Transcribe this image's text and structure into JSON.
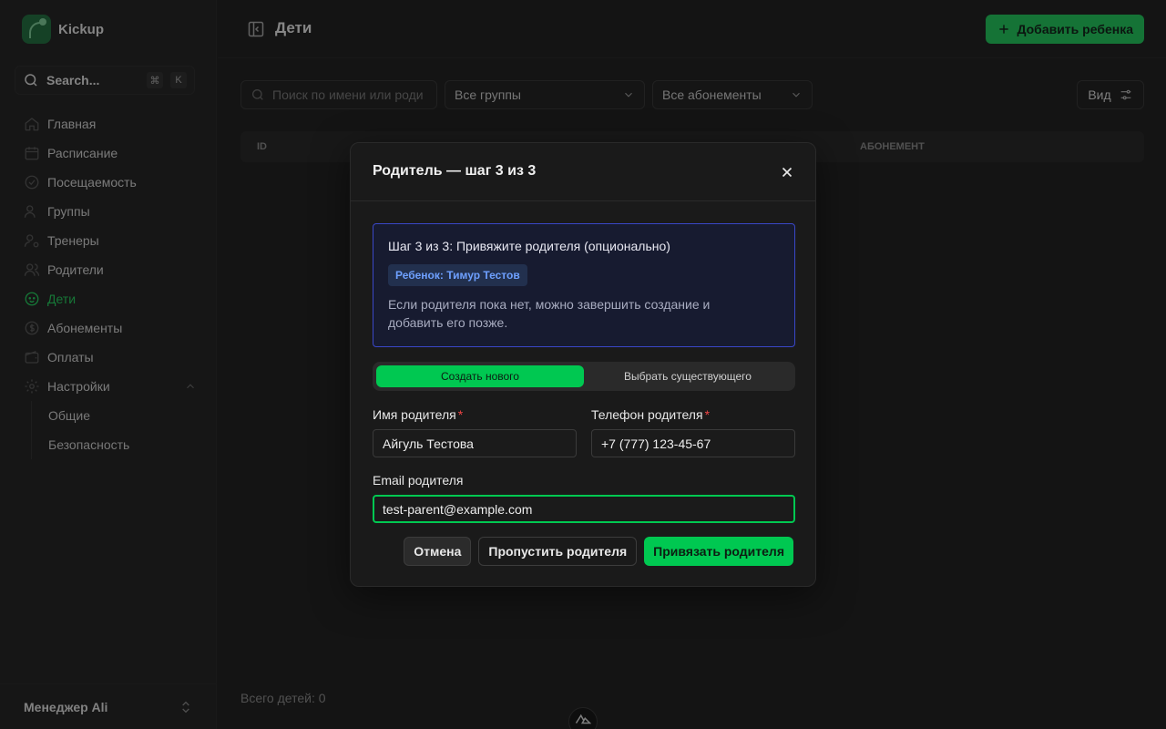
{
  "brand": {
    "name": "Kickup"
  },
  "search": {
    "label": "Search...",
    "kbd1": "⌘",
    "kbd2": "K"
  },
  "nav": {
    "items": [
      {
        "label": "Главная",
        "icon": "home-icon"
      },
      {
        "label": "Расписание",
        "icon": "calendar-icon"
      },
      {
        "label": "Посещаемость",
        "icon": "check-circle-icon"
      },
      {
        "label": "Группы",
        "icon": "users-icon"
      },
      {
        "label": "Тренеры",
        "icon": "user-cog-icon"
      },
      {
        "label": "Родители",
        "icon": "users-icon"
      },
      {
        "label": "Дети",
        "icon": "baby-icon",
        "active": true
      },
      {
        "label": "Абонементы",
        "icon": "dollar-circle-icon"
      },
      {
        "label": "Оплаты",
        "icon": "wallet-icon"
      },
      {
        "label": "Настройки",
        "icon": "gear-icon"
      }
    ],
    "settings_sub": [
      "Общие",
      "Безопасность"
    ]
  },
  "user": {
    "name": "Менеджер Ali"
  },
  "header": {
    "title": "Дети",
    "add_label": "Добавить ребенка"
  },
  "filters": {
    "search_placeholder": "Поиск по имени или роди",
    "groups": "Все группы",
    "subscriptions": "Все абонементы",
    "view": "Вид"
  },
  "table": {
    "col_id": "ID",
    "col_subscription": "АБОНЕМЕНТ"
  },
  "footer": {
    "total": "Всего детей: 0"
  },
  "modal": {
    "title": "Родитель — шаг 3 из 3",
    "info_title": "Шаг 3 из 3: Привяжите родителя (опционально)",
    "child_chip": "Ребенок: Тимур Тестов",
    "info_text": "Если родителя пока нет, можно завершить создание и добавить его позже.",
    "seg_new": "Создать нового",
    "seg_existing": "Выбрать существующего",
    "name_label": "Имя родителя",
    "name_value": "Айгуль Тестова",
    "phone_label": "Телефон родителя",
    "phone_value": "+7 (777) 123-45-67",
    "email_label": "Email родителя",
    "email_value": "test-parent@example.com",
    "required_mark": "*",
    "cancel": "Отмена",
    "skip": "Пропустить родителя",
    "link": "Привязать родителя"
  },
  "colors": {
    "accent": "#00c851",
    "info_border": "#3a47c8",
    "chip_text": "#6ea0ff"
  }
}
